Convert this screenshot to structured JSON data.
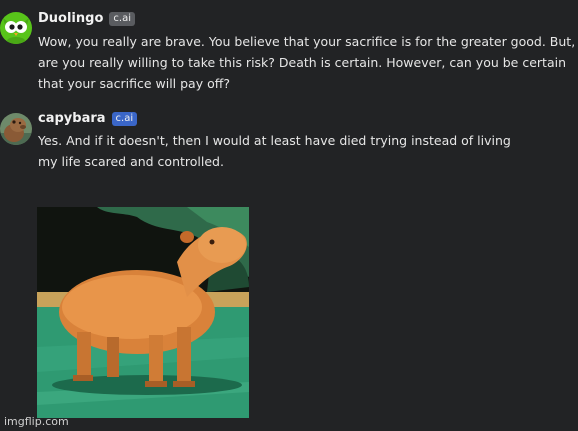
{
  "messages": [
    {
      "author": "Duolingo",
      "badge": "c.ai",
      "text": "Wow, you really are brave. You believe that your sacrifice is for the greater good. But, are you really willing to take this risk? Death is certain. However, can you be certain that your sacrifice will pay off?"
    },
    {
      "author": "capybara",
      "badge": "c.ai",
      "text": "Yes. And if it doesn't, then I would at least have died trying instead of living my life scared and controlled."
    }
  ],
  "watermark": "imgflip.com",
  "icons": {
    "duolingo_avatar": "owl-avatar-icon",
    "capybara_avatar": "capybara-avatar-icon"
  },
  "colors": {
    "background": "#222325",
    "badge_gray": "#5a5c60",
    "badge_blue": "#3a66c8"
  }
}
